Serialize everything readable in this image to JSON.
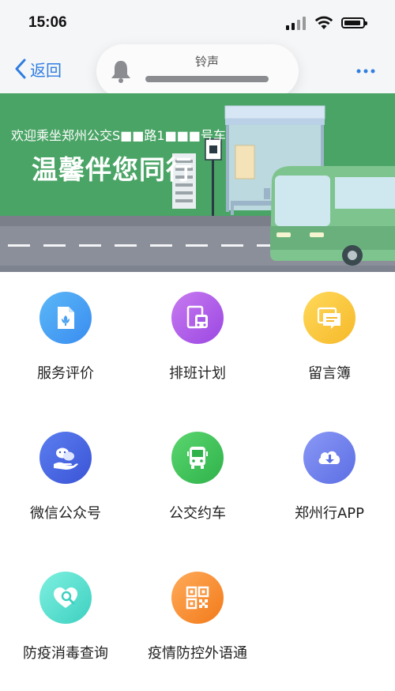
{
  "status_bar": {
    "time": "15:06"
  },
  "nav": {
    "back_label": "返回",
    "more_label": "···"
  },
  "ringer": {
    "title": "铃声"
  },
  "banner": {
    "line1": "欢迎乘坐郑州公交S■■路1■■■号车",
    "line2": "温馨伴您同行"
  },
  "menu": [
    {
      "label": "服务评价",
      "icon": "document-flower-icon",
      "color_from": "#5bb8f7",
      "color_to": "#3a8cf0"
    },
    {
      "label": "排班计划",
      "icon": "bus-schedule-icon",
      "color_from": "#c77bf0",
      "color_to": "#9b47e2"
    },
    {
      "label": "留言簿",
      "icon": "message-book-icon",
      "color_from": "#ffd95a",
      "color_to": "#f6b92a"
    },
    {
      "label": "微信公众号",
      "icon": "wechat-hand-icon",
      "color_from": "#5b7ef0",
      "color_to": "#3b54d6"
    },
    {
      "label": "公交约车",
      "icon": "bus-icon",
      "color_from": "#5bd66f",
      "color_to": "#2fb24a"
    },
    {
      "label": "郑州行APP",
      "icon": "cloud-download-icon",
      "color_from": "#8a98f5",
      "color_to": "#5c6ee4"
    },
    {
      "label": "防疫消毒查询",
      "icon": "heart-search-icon",
      "color_from": "#7ff0e0",
      "color_to": "#3dd0c0"
    },
    {
      "label": "疫情防控外语通",
      "icon": "qr-code-icon",
      "color_from": "#ffab5a",
      "color_to": "#f27a1a"
    }
  ]
}
